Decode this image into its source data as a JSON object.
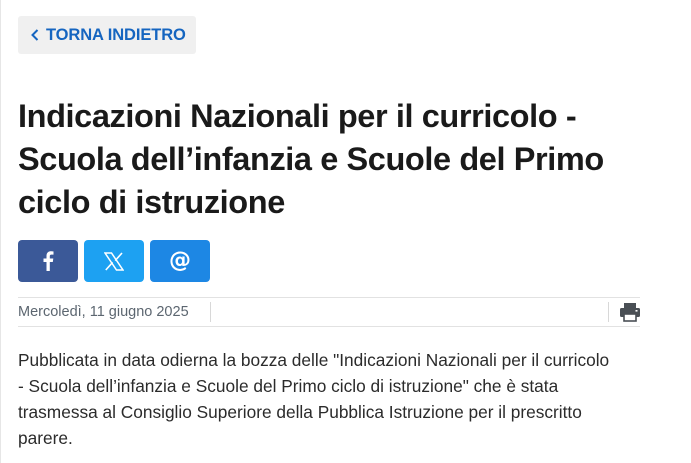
{
  "nav": {
    "back_label": "TORNA INDIETRO"
  },
  "article": {
    "title": "Indicazioni Nazionali per il curricolo - Scuola dell’infanzia e Scuole del Primo ciclo di istruzione",
    "date": "Mercoledì, 11 giugno 2025",
    "body": "Pubblicata in data odierna la bozza delle \"Indicazioni Nazionali per il curricolo - Scuola dell’infanzia e Scuole del Primo ciclo di istruzione\" che è stata trasmessa al Consiglio Superiore della Pubblica Istruzione per il prescritto parere."
  },
  "share": {
    "facebook_icon": "facebook-icon",
    "x_icon": "x-icon",
    "email_icon": "at-icon",
    "email_glyph": "@"
  },
  "tools": {
    "print_icon": "printer-icon"
  },
  "colors": {
    "link": "#1565c0",
    "facebook": "#3b5998",
    "x": "#1da1f2",
    "email": "#1d87e4"
  }
}
